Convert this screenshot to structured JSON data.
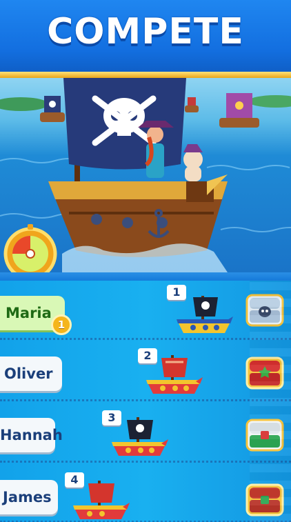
{
  "header": {
    "title": "COMPETE"
  },
  "colors": {
    "header_blue": "#136fe0",
    "gold": "#f5b51b",
    "lane_water": "#19b0f0",
    "first_place_green": "#d9f8b6"
  },
  "scene": {
    "flag_icon": "skull-crossbones-icon",
    "timer_icon": "compass-timer-icon"
  },
  "leaderboard": [
    {
      "name": "Maria",
      "position": "1",
      "medal": "1",
      "ship_sail": "black-skull",
      "chest": "silver-chest-icon"
    },
    {
      "name": "Oliver",
      "position": "2",
      "ship_sail": "red",
      "chest": "gold-red-chest-icon"
    },
    {
      "name": "Hannah",
      "position": "3",
      "ship_sail": "black-skull",
      "chest": "white-green-chest-icon"
    },
    {
      "name": "James",
      "position": "4",
      "ship_sail": "red",
      "chest": "red-chest-icon"
    }
  ]
}
